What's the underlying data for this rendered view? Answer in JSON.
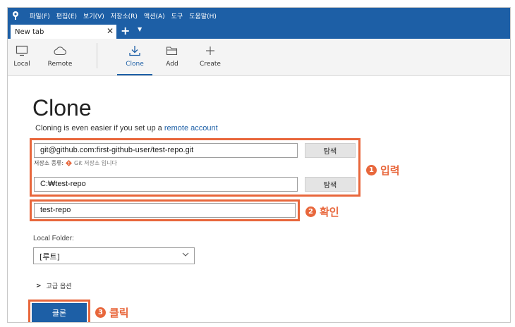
{
  "menu": {
    "items": [
      "파일(F)",
      "편집(E)",
      "보기(V)",
      "저장소(R)",
      "액션(A)",
      "도구",
      "도움말(H)"
    ]
  },
  "tabs": {
    "active_label": "New tab",
    "close_glyph": "✕",
    "plus_glyph": "+",
    "dropdown_glyph": "▼"
  },
  "toolbar": {
    "local_label": "Local",
    "remote_label": "Remote",
    "clone_label": "Clone",
    "add_label": "Add",
    "create_label": "Create"
  },
  "main": {
    "title": "Clone",
    "subtitle_prefix": "Cloning is even easier if you set up a ",
    "subtitle_link": "remote account",
    "source_url": "git@github.com:first-github-user/test-repo.git",
    "browse_label": "탐색",
    "repo_type_label": "저장소 종류:",
    "repo_type_value": "Git 저장소 입니다",
    "dest_path": "C:₩test-repo",
    "browse_label_2": "탐색",
    "name_value": "test-repo",
    "local_folder_label": "Local Folder:",
    "local_folder_value": "[루트]",
    "advanced_label": "고급 옵션",
    "clone_button_label": "클론"
  },
  "annotations": {
    "a1_num": "1",
    "a1_text": "입력",
    "a2_num": "2",
    "a2_text": "확인",
    "a3_num": "3",
    "a3_text": "클릭"
  },
  "colors": {
    "accent": "#1d5fa6",
    "highlight": "#e8673c",
    "git": "#e8673c"
  }
}
